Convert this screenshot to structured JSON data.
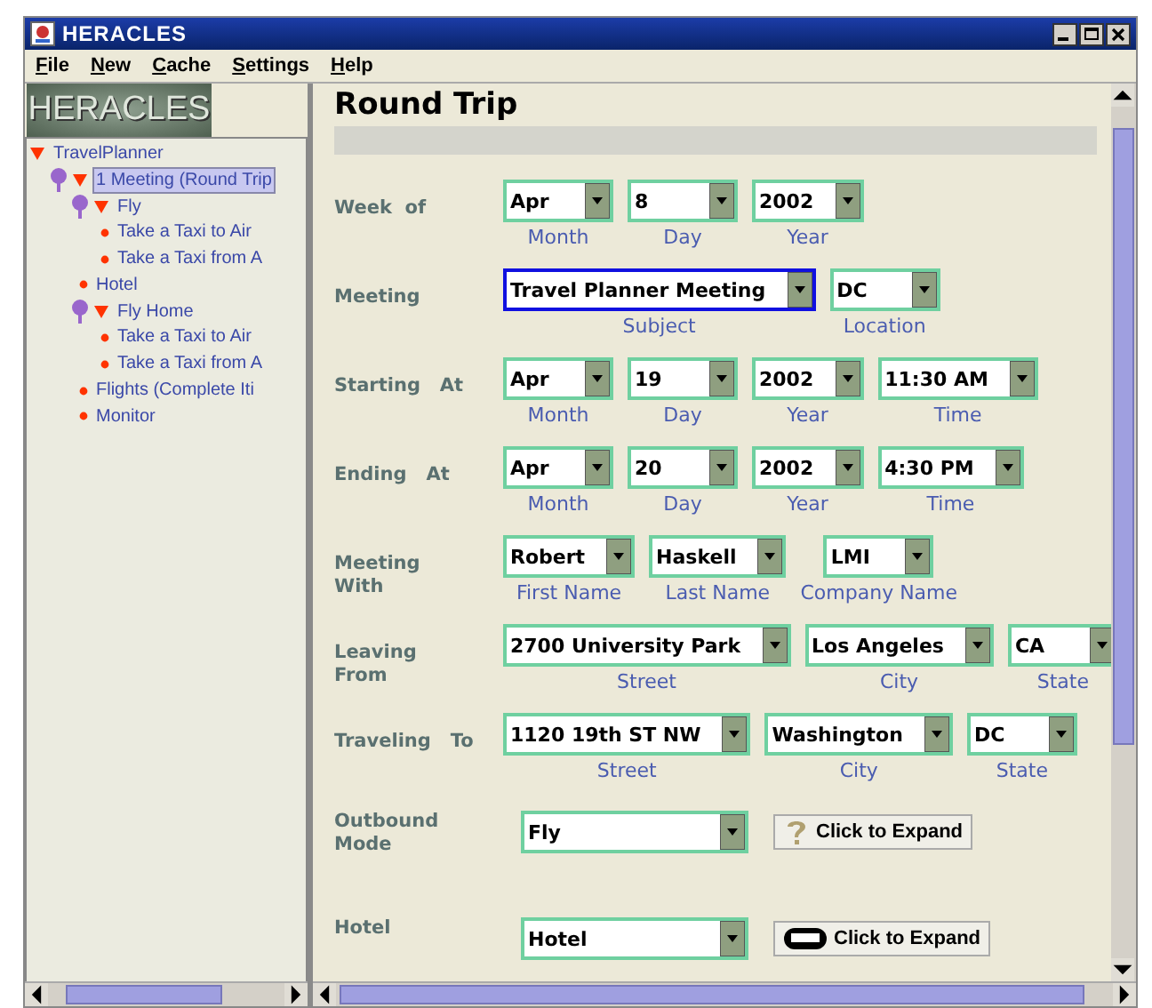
{
  "window": {
    "title": "HERACLES"
  },
  "menu": [
    {
      "label": "File"
    },
    {
      "label": "New"
    },
    {
      "label": "Cache"
    },
    {
      "label": "Settings"
    },
    {
      "label": "Help"
    }
  ],
  "sidebar": {
    "logo": "HERACLES",
    "tree": [
      {
        "label": "TravelPlanner",
        "kind": "root",
        "expanded": true,
        "selected": false,
        "children": [
          {
            "label": "1 Meeting (Round Trip",
            "kind": "pinned",
            "expanded": true,
            "selected": true,
            "children": [
              {
                "label": "Fly",
                "kind": "pinned",
                "expanded": true,
                "selected": false,
                "children": [
                  {
                    "label": "Take a Taxi to Air",
                    "kind": "leaf",
                    "selected": false
                  },
                  {
                    "label": "Take a Taxi from A",
                    "kind": "leaf",
                    "selected": false
                  }
                ]
              },
              {
                "label": "Hotel",
                "kind": "leaf",
                "selected": false
              },
              {
                "label": "Fly Home",
                "kind": "pinned",
                "expanded": true,
                "selected": false,
                "children": [
                  {
                    "label": "Take a Taxi to Air",
                    "kind": "leaf",
                    "selected": false
                  },
                  {
                    "label": "Take a Taxi from A",
                    "kind": "leaf",
                    "selected": false
                  }
                ]
              },
              {
                "label": "Flights (Complete Iti",
                "kind": "leaf",
                "selected": false
              },
              {
                "label": "Monitor",
                "kind": "leaf",
                "selected": false
              }
            ]
          }
        ]
      }
    ]
  },
  "form": {
    "title": "Round Trip",
    "rows": [
      {
        "label": "Week  of",
        "fields": [
          {
            "value": "Apr",
            "caption": "Month",
            "focused": false
          },
          {
            "value": "8",
            "caption": "Day",
            "focused": false
          },
          {
            "value": "2002",
            "caption": "Year",
            "focused": false
          }
        ]
      },
      {
        "label": "Meeting",
        "fields": [
          {
            "value": "Travel Planner Meeting",
            "caption": "Subject",
            "focused": true
          },
          {
            "value": "DC",
            "caption": "Location",
            "focused": false
          }
        ]
      },
      {
        "label": "Starting   At",
        "fields": [
          {
            "value": "Apr",
            "caption": "Month",
            "focused": false
          },
          {
            "value": "19",
            "caption": "Day",
            "focused": false
          },
          {
            "value": "2002",
            "caption": "Year",
            "focused": false
          },
          {
            "value": "11:30 AM",
            "caption": "Time",
            "focused": false
          }
        ]
      },
      {
        "label": "Ending   At",
        "fields": [
          {
            "value": "Apr",
            "caption": "Month",
            "focused": false
          },
          {
            "value": "20",
            "caption": "Day",
            "focused": false
          },
          {
            "value": "2002",
            "caption": "Year",
            "focused": false
          },
          {
            "value": "4:30 PM",
            "caption": "Time",
            "focused": false
          }
        ]
      },
      {
        "label": "Meeting\nWith",
        "fields": [
          {
            "value": "Robert",
            "caption": "First Name",
            "focused": false
          },
          {
            "value": "Haskell",
            "caption": "Last Name",
            "focused": false
          },
          {
            "value": "LMI",
            "caption": "Company Name",
            "focused": false
          }
        ]
      },
      {
        "label": "Leaving\nFrom",
        "fields": [
          {
            "value": "2700 University Park",
            "caption": "Street",
            "focused": false
          },
          {
            "value": "Los Angeles",
            "caption": "City",
            "focused": false
          },
          {
            "value": "CA",
            "caption": "State",
            "focused": false
          }
        ]
      },
      {
        "label": "Traveling   To",
        "fields": [
          {
            "value": "1120 19th ST NW",
            "caption": "Street",
            "focused": false
          },
          {
            "value": "Washington",
            "caption": "City",
            "focused": false
          },
          {
            "value": "DC",
            "caption": "State",
            "focused": false
          }
        ]
      },
      {
        "label": "Outbound\nMode",
        "kind": "mode",
        "fields": [
          {
            "value": "Fly",
            "focused": false
          }
        ],
        "button": {
          "label": "Click to Expand",
          "kind": "help"
        }
      },
      {
        "label": "Hotel",
        "kind": "mode",
        "fields": [
          {
            "value": "Hotel",
            "focused": false
          }
        ],
        "button": {
          "label": "Click to Expand",
          "kind": "lodging"
        }
      }
    ]
  }
}
